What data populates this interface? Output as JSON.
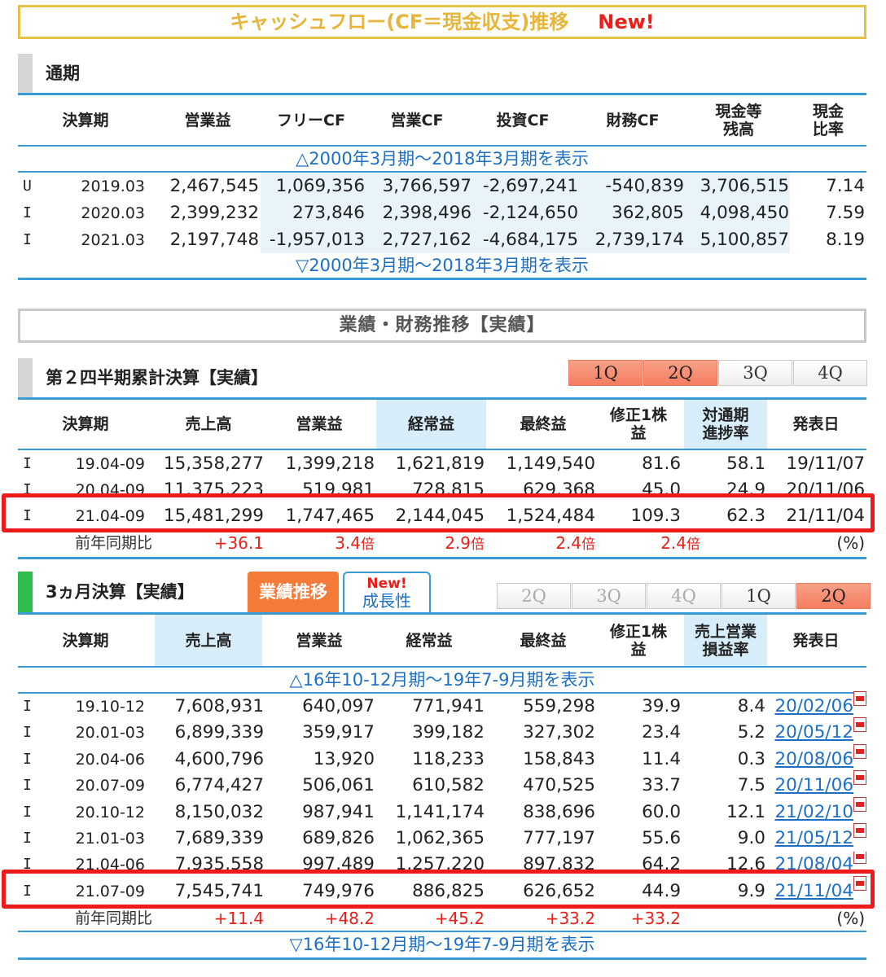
{
  "cf": {
    "banner_title": "キャッシュフロー(CF＝現金収支)推移",
    "banner_new": "New!",
    "section_title": "通期",
    "headers": [
      "決算期",
      "営業益",
      "フリーCF",
      "営業CF",
      "投資CF",
      "財務CF",
      "現金等残高",
      "現金比率"
    ],
    "header_cash_l1": "現金等",
    "header_cash_l2": "残高",
    "header_ratio_l1": "現金",
    "header_ratio_l2": "比率",
    "show_more_top": "△2000年3月期～2018年3月期を表示",
    "show_more_bottom": "▽2000年3月期～2018年3月期を表示",
    "rows": [
      [
        "U",
        "2019.03",
        "2,467,545",
        "1,069,356",
        "3,766,597",
        "-2,697,241",
        "-540,839",
        "3,706,515",
        "7.14"
      ],
      [
        "I",
        "2020.03",
        "2,399,232",
        "273,846",
        "2,398,496",
        "-2,124,650",
        "362,805",
        "4,098,450",
        "7.59"
      ],
      [
        "I",
        "2021.03",
        "2,197,748",
        "-1,957,013",
        "2,727,162",
        "-4,684,175",
        "2,739,174",
        "5,100,857",
        "8.19"
      ]
    ]
  },
  "perf_banner": "業績・財務推移【実績】",
  "q2": {
    "section_title": "第２四半期累計決算【実績】",
    "tabs": [
      "1Q",
      "2Q",
      "3Q",
      "4Q"
    ],
    "headers": [
      "決算期",
      "売上高",
      "営業益",
      "経常益",
      "最終益",
      "修正1株益",
      "対通期進捗率",
      "発表日"
    ],
    "h_eps_l1": "修正1株",
    "h_eps_l2": "益",
    "h_prog_l1": "対通期",
    "h_prog_l2": "進捗率",
    "rows": [
      [
        "I",
        "19.04-09",
        "15,358,277",
        "1,399,218",
        "1,621,819",
        "1,149,540",
        "81.6",
        "58.1",
        "19/11/07"
      ],
      [
        "I",
        "20.04-09",
        "11,375,223",
        "519,981",
        "728,815",
        "629,368",
        "45.0",
        "24.9",
        "20/11/06"
      ],
      [
        "I",
        "21.04-09",
        "15,481,299",
        "1,747,465",
        "2,144,045",
        "1,524,484",
        "109.3",
        "62.3",
        "21/11/04"
      ]
    ],
    "yoy": {
      "label": "前年同期比",
      "values": [
        "+36.1",
        "3.4",
        "2.9",
        "2.4",
        "2.4"
      ],
      "unit_x": "倍",
      "pct": "(%)"
    }
  },
  "m3": {
    "section_title": "3ヵ月決算【実績】",
    "tab_perf": "業績推移",
    "tab_new": "New!",
    "tab_growth": "成長性",
    "tabs": [
      "2Q",
      "3Q",
      "4Q",
      "1Q",
      "2Q"
    ],
    "headers": [
      "決算期",
      "売上高",
      "営業益",
      "経常益",
      "最終益",
      "修正1株益",
      "売上営業損益率",
      "発表日"
    ],
    "h_eps_l1": "修正1株",
    "h_eps_l2": "益",
    "h_margin_l1": "売上営業",
    "h_margin_l2": "損益率",
    "show_more_top": "△16年10-12月期～19年7-9月期を表示",
    "show_more_bottom": "▽16年10-12月期～19年7-9月期を表示",
    "rows": [
      [
        "I",
        "19.10-12",
        "7,608,931",
        "640,097",
        "771,941",
        "559,298",
        "39.9",
        "8.4",
        "20/02/06"
      ],
      [
        "I",
        "20.01-03",
        "6,899,339",
        "359,917",
        "399,182",
        "327,302",
        "23.4",
        "5.2",
        "20/05/12"
      ],
      [
        "I",
        "20.04-06",
        "4,600,796",
        "13,920",
        "118,233",
        "158,843",
        "11.4",
        "0.3",
        "20/08/06"
      ],
      [
        "I",
        "20.07-09",
        "6,774,427",
        "506,061",
        "610,582",
        "470,525",
        "33.7",
        "7.5",
        "20/11/06"
      ],
      [
        "I",
        "20.10-12",
        "8,150,032",
        "987,941",
        "1,141,174",
        "838,696",
        "60.0",
        "12.1",
        "21/02/10"
      ],
      [
        "I",
        "21.01-03",
        "7,689,339",
        "689,826",
        "1,062,365",
        "777,197",
        "55.6",
        "9.0",
        "21/05/12"
      ],
      [
        "I",
        "21.04-06",
        "7,935,558",
        "997,489",
        "1,257,220",
        "897,832",
        "64.2",
        "12.6",
        "21/08/04"
      ],
      [
        "I",
        "21.07-09",
        "7,545,741",
        "749,976",
        "886,825",
        "626,652",
        "44.9",
        "9.9",
        "21/11/04"
      ]
    ],
    "yoy": {
      "label": "前年同期比",
      "values": [
        "+11.4",
        "+48.2",
        "+45.2",
        "+33.2",
        "+33.2"
      ],
      "pct": "(%)"
    }
  },
  "colors": {
    "accent_blue": "#3a9ad6",
    "highlight_red": "#ee1b1b",
    "banner_gold": "#e6c244",
    "tab_orange": "#f47a38"
  }
}
